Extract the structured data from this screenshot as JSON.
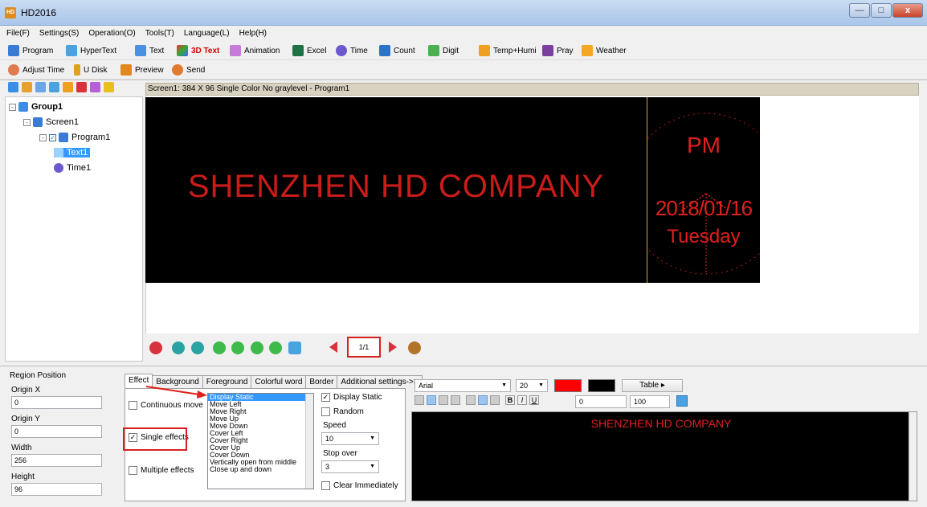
{
  "window": {
    "title": "HD2016",
    "app_icon_text": "HD",
    "min": "—",
    "max": "□",
    "close": "x"
  },
  "menu": [
    "File(F)",
    "Settings(S)",
    "Operation(O)",
    "Tools(T)",
    "Language(L)",
    "Help(H)"
  ],
  "toolbar1": {
    "program": "Program",
    "hypertext": "HyperText",
    "text": "Text",
    "text3d": "3D Text",
    "animation": "Animation",
    "excel": "Excel",
    "time": "Time",
    "count": "Count",
    "digit": "Digit",
    "temphumi": "Temp+Humi",
    "pray": "Pray",
    "weather": "Weather"
  },
  "toolbar2": {
    "adjust_time": "Adjust Time",
    "udisk": "U Disk",
    "preview": "Preview",
    "send": "Send"
  },
  "tree": {
    "group": "Group1",
    "screen": "Screen1",
    "program": "Program1",
    "text": "Text1",
    "time": "Time1",
    "expand": "-",
    "collapse": "-",
    "checked": "✓"
  },
  "preview": {
    "header": "Screen1: 384 X 96  Single Color No graylevel - Program1",
    "led_text": "SHENZHEN HD COMPANY",
    "clock": {
      "ampm": "PM",
      "date": "2018/01/16",
      "weekday": "Tuesday"
    }
  },
  "nav": {
    "page": "1/1"
  },
  "region": {
    "title": "Region Position",
    "origin_x_label": "Origin X",
    "origin_x": "0",
    "origin_y_label": "Origin Y",
    "origin_y": "0",
    "width_label": "Width",
    "width": "256",
    "height_label": "Height",
    "height": "96"
  },
  "tabs": [
    "Effect",
    "Background",
    "Foreground",
    "Colorful word",
    "Border",
    "Additional settings->>"
  ],
  "effect": {
    "continuous_move": "Continuous move",
    "single_effects": "Single effects",
    "multiple_effects": "Multiple effects",
    "list": [
      "Display Static",
      "Move Left",
      "Move Right",
      "Move Up",
      "Move Down",
      "Cover Left",
      "Cover Right",
      "Cover Up",
      "Cover Down",
      "Vertically open from middle",
      "Close up and down"
    ],
    "display_static": "Display Static",
    "random": "Random",
    "speed_label": "Speed",
    "speed": "10",
    "stop_over_label": "Stop over",
    "stop_over": "3",
    "clear_immediately": "Clear Immediately",
    "check_mark": "✓"
  },
  "editor": {
    "font": "Arial",
    "size": "20",
    "table": "Table",
    "spacing": "0",
    "scale": "100",
    "text": "SHENZHEN HD COMPANY",
    "fg_color": "#ff0000",
    "bg_color": "#000000"
  },
  "colors": {
    "led_red": "#e0201b",
    "highlight": "#d82020",
    "selection": "#3399ff"
  }
}
